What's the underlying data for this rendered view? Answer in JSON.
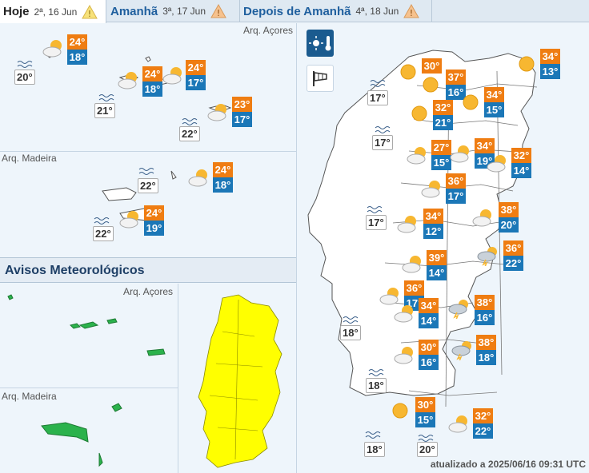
{
  "tabs": [
    {
      "name": "Hoje",
      "date": "2ª, 16 Jun",
      "active": true
    },
    {
      "name": "Amanhã",
      "date": "3ª, 17 Jun",
      "active": false
    },
    {
      "name": "Depois de Amanhã",
      "date": "4ª, 18 Jun",
      "active": false
    }
  ],
  "islands": {
    "acores_label": "Arq. Açores",
    "madeira_label": "Arq. Madeira",
    "acores": [
      {
        "max": "24°",
        "min": "18°",
        "icon": "sun-cloud-icon"
      },
      {
        "max": "24°",
        "min": "18°",
        "icon": "sun-cloud-icon"
      },
      {
        "max": "24°",
        "min": "17°",
        "icon": "sun-cloud-icon"
      },
      {
        "max": "23°",
        "min": "17°",
        "icon": "sun-cloud-icon"
      }
    ],
    "acores_sea": [
      "20°",
      "21°",
      "22°"
    ],
    "madeira": [
      {
        "max": "24°",
        "min": "18°",
        "icon": "sun-cloud-icon"
      },
      {
        "max": "24°",
        "min": "19°",
        "icon": "sun-cloud-icon"
      }
    ],
    "madeira_sea": [
      "22°",
      "22°"
    ]
  },
  "avisos": {
    "title": "Avisos Meteorológicos",
    "acores_label": "Arq. Açores",
    "madeira_label": "Arq. Madeira",
    "colors": {
      "green": "#2bb24c",
      "yellow": "#ffff00"
    }
  },
  "mainland": {
    "cities": [
      {
        "max": "30°",
        "min": "",
        "icon": "sun-icon"
      },
      {
        "max": "37°",
        "min": "16°",
        "icon": "sun-icon"
      },
      {
        "max": "34°",
        "min": "13°",
        "icon": "sun-icon"
      },
      {
        "max": "34°",
        "min": "15°",
        "icon": "sun-icon"
      },
      {
        "max": "32°",
        "min": "21°",
        "icon": "sun-icon"
      },
      {
        "max": "27°",
        "min": "15°",
        "icon": "sun-cloud-icon"
      },
      {
        "max": "34°",
        "min": "19°",
        "icon": "sun-cloud-icon"
      },
      {
        "max": "32°",
        "min": "14°",
        "icon": "sun-cloud-icon"
      },
      {
        "max": "36°",
        "min": "17°",
        "icon": "sun-cloud-icon"
      },
      {
        "max": "34°",
        "min": "12°",
        "icon": "sun-cloud-icon"
      },
      {
        "max": "38°",
        "min": "20°",
        "icon": "sun-cloud-icon"
      },
      {
        "max": "39°",
        "min": "14°",
        "icon": "sun-cloud-icon"
      },
      {
        "max": "36°",
        "min": "22°",
        "icon": "storm-icon"
      },
      {
        "max": "36°",
        "min": "17°",
        "icon": "sun-cloud-icon"
      },
      {
        "max": "34°",
        "min": "14°",
        "icon": "sun-cloud-icon"
      },
      {
        "max": "38°",
        "min": "16°",
        "icon": "storm-icon"
      },
      {
        "max": "30°",
        "min": "16°",
        "icon": "sun-cloud-icon"
      },
      {
        "max": "38°",
        "min": "18°",
        "icon": "storm-icon"
      },
      {
        "max": "30°",
        "min": "15°",
        "icon": "sun-icon"
      },
      {
        "max": "32°",
        "min": "22°",
        "icon": "sun-cloud-icon"
      }
    ],
    "sea": [
      "17°",
      "17°",
      "17°",
      "18°",
      "18°",
      "18°",
      "20°"
    ]
  },
  "updated": "atualizado a 2025/06/16 09:31 UTC"
}
